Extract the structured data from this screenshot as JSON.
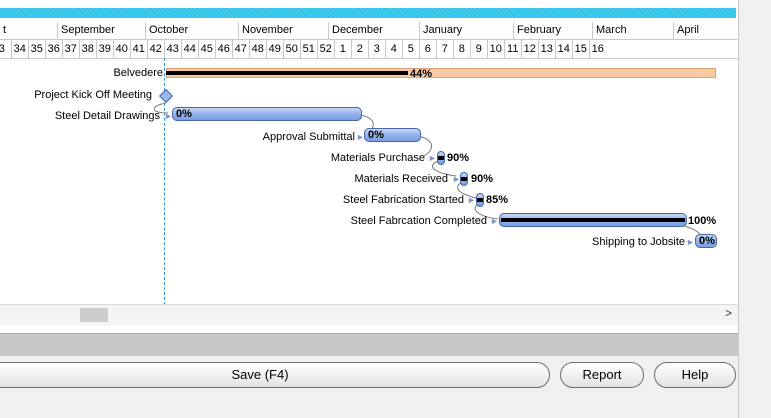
{
  "timeline": {
    "months": [
      "t",
      "September",
      "October",
      "November",
      "December",
      "January",
      "February",
      "March",
      "April"
    ],
    "weeks": [
      "3",
      "34",
      "35",
      "36",
      "37",
      "38",
      "39",
      "40",
      "41",
      "42",
      "43",
      "44",
      "45",
      "46",
      "47",
      "48",
      "49",
      "50",
      "51",
      "52",
      "1",
      "2",
      "3",
      "4",
      "5",
      "6",
      "7",
      "8",
      "9",
      "10",
      "11",
      "12",
      "13",
      "14",
      "15",
      "16"
    ]
  },
  "tasks": [
    {
      "name": "Belvedere",
      "pct": "44%"
    },
    {
      "name": "Project Kick Off Meeting",
      "pct": ""
    },
    {
      "name": "Steel Detail Drawings",
      "pct": "0%"
    },
    {
      "name": "Approval Submittal",
      "pct": "0%"
    },
    {
      "name": "Materials Purchase",
      "pct": "90%"
    },
    {
      "name": "Materials Received",
      "pct": "90%"
    },
    {
      "name": "Steel Fabrication Started",
      "pct": "85%"
    },
    {
      "name": "Steel Fabrcation Completed",
      "pct": "100%"
    },
    {
      "name": "Shipping to Jobsite",
      "pct": "0%"
    }
  ],
  "scroll": {
    "right_arrow": ">"
  },
  "buttons": {
    "save": "Save (F4)",
    "report": "Report",
    "help": "Help"
  }
}
